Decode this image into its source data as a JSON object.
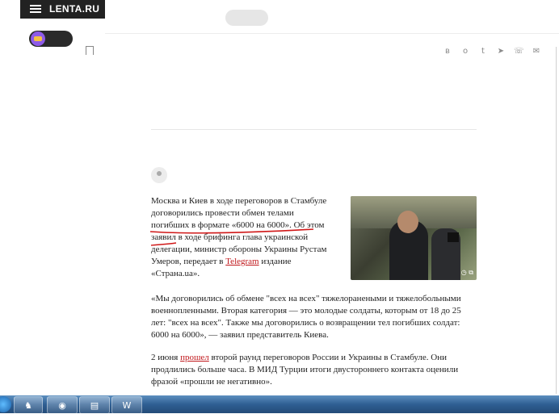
{
  "header": {
    "logo": "LENTA.RU"
  },
  "share": {
    "icons": [
      "vk-icon",
      "ok-icon",
      "twitter-icon",
      "telegram-icon",
      "whatsapp-icon",
      "mail-icon"
    ],
    "glyphs": [
      "в",
      "о",
      "t",
      "➤",
      "☏",
      "✉"
    ]
  },
  "article": {
    "p1_a": "Москва и Киев в ходе переговоров в Стамбуле договорились провести обмен ",
    "p1_link": "телами погибших в формате «6000 на 6000»",
    "p1_b": ". Об этом заявил в ходе брифинга глава украинской делегации, министр обороны Украины Рустам Умеров, передает в ",
    "p1_link2": "Telegram",
    "p1_c": " издание «Страна.ua».",
    "p2": "«Мы договорились об обмене \"всех на всех\" тяжелоранеными и тяжелобольными военнопленными. Вторая категория — это молодые солдаты, которым от 18 до 25 лет: \"всех на всех\". Также мы договорились о возвращении тел погибших солдат: 6000 на 6000», — заявил представитель Киева.",
    "p3_a": "2 июня ",
    "p3_link": "прошел",
    "p3_b": " второй раунд переговоров России и Украины в Стамбуле. Они продлились больше часа. В МИД Турции итоги двустороннего контакта оценили фразой «прошли не негативно».",
    "photo_badge": "◷ ⧉"
  },
  "taskbar": {
    "apps": [
      "game-icon",
      "chrome-icon",
      "folder-icon",
      "word-icon"
    ],
    "glyphs": [
      "♞",
      "◉",
      "▤",
      "W"
    ]
  },
  "colors": {
    "accent": "#c0171b",
    "logo_bg": "#222222",
    "taskbar": "#2f5f93"
  }
}
